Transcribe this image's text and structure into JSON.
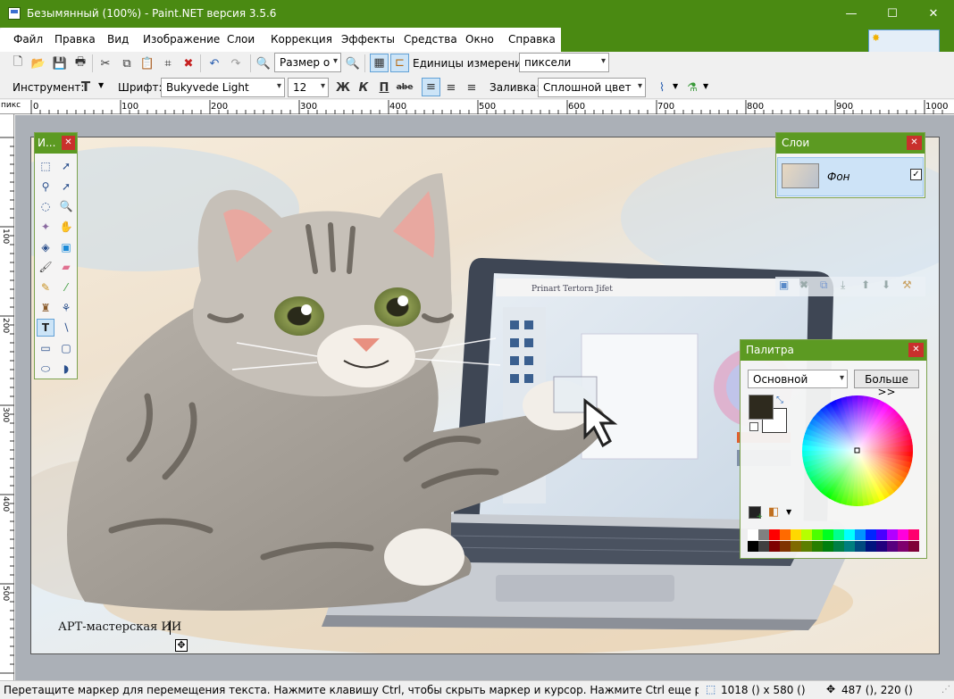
{
  "window": {
    "title": "Безымянный (100%) - Paint.NET версия 3.5.6",
    "minimize_glyph": "—",
    "maximize_glyph": "☐",
    "close_glyph": "✕"
  },
  "menu": [
    {
      "label": "Файл"
    },
    {
      "label": "Правка"
    },
    {
      "label": "Вид"
    },
    {
      "label": "Изображение"
    },
    {
      "label": "Слои"
    },
    {
      "label": "Коррекция"
    },
    {
      "label": "Эффекты"
    },
    {
      "label": "Средства"
    },
    {
      "label": "Окно"
    },
    {
      "label": "Справка"
    }
  ],
  "toolbar": {
    "zoom_combo": "Размер о",
    "units_label": "Единицы измерения:",
    "units_value": "пиксели",
    "tool_label": "Инструмент:",
    "font_label": "Шрифт:",
    "font_value": "Bukyvede Light",
    "size_value": "12",
    "bold": "Ж",
    "italic": "К",
    "underline": "П",
    "strike": "abe",
    "fill_label": "Заливка:",
    "fill_value": "Сплошной цвет"
  },
  "ruler": {
    "unit": "пикс",
    "h_labels": [
      "0",
      "100",
      "200",
      "300",
      "400",
      "500",
      "600",
      "700",
      "800",
      "900",
      "1000"
    ],
    "v_labels": [
      "100",
      "200",
      "300",
      "400",
      "500"
    ]
  },
  "tools_window": {
    "title": "И..."
  },
  "layers_window": {
    "title": "Слои",
    "layer_name": "Фон",
    "layer_visible": true
  },
  "palette_window": {
    "title": "Палитра",
    "mode": "Основной",
    "more_button": "Больше >>",
    "primary_color": "#2e2a1e",
    "secondary_color": "#ffffff",
    "palette_row1": [
      "#ffffff",
      "#808080",
      "#ff0000",
      "#ff6a00",
      "#ffd800",
      "#b6ff00",
      "#4cff00",
      "#00ff21",
      "#00ff90",
      "#00ffff",
      "#0094ff",
      "#0026ff",
      "#4800ff",
      "#b200ff",
      "#ff00dc",
      "#ff006e"
    ],
    "palette_row2": [
      "#000000",
      "#404040",
      "#7f0000",
      "#7f3300",
      "#7f6a00",
      "#5b7f00",
      "#267f00",
      "#007f0e",
      "#007f46",
      "#007f7f",
      "#004a7f",
      "#00137f",
      "#21007f",
      "#57007f",
      "#7f006e",
      "#7f0037"
    ]
  },
  "canvas": {
    "text": "АРТ-мастерская ИИ"
  },
  "laptop_screen": {
    "menu_text": "Prinart  Tertorn  Jifet"
  },
  "status": {
    "message": "Перетащите маркер для перемещения текста. Нажмите клавишу Ctrl, чтобы скрыть маркер и курсор. Нажмите Ctrl еще раз для отображени",
    "image_size": "1018 () x 580 ()",
    "cursor_pos": "487 (), 220 ()"
  }
}
